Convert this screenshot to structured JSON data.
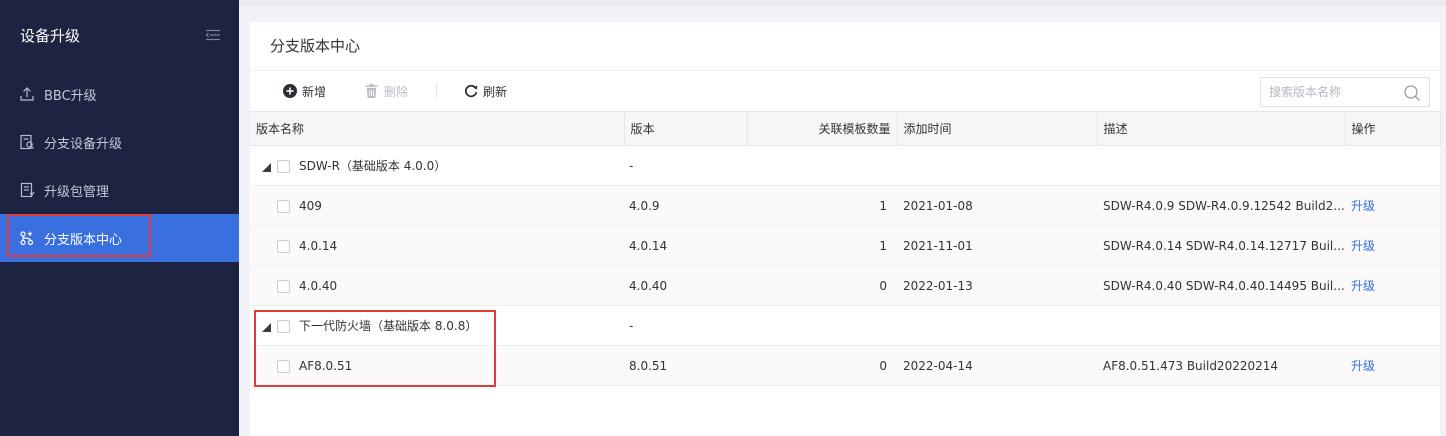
{
  "sidebar": {
    "title": "设备升级",
    "collapse_icon": "collapse-icon",
    "items": [
      {
        "label": "BBC升级",
        "icon": "upload-icon",
        "active": false
      },
      {
        "label": "分支设备升级",
        "icon": "device-search-icon",
        "active": false
      },
      {
        "label": "升级包管理",
        "icon": "package-icon",
        "active": false
      },
      {
        "label": "分支版本中心",
        "icon": "branch-version-icon",
        "active": true
      }
    ]
  },
  "panel": {
    "title": "分支版本中心"
  },
  "toolbar": {
    "add_label": "新增",
    "delete_label": "删除",
    "refresh_label": "刷新",
    "search_placeholder": "搜索版本名称"
  },
  "table": {
    "columns": [
      "版本名称",
      "版本",
      "关联模板数量",
      "添加时间",
      "描述",
      "操作"
    ],
    "groups": [
      {
        "name": "SDW-R（基础版本 4.0.0）",
        "version": "-",
        "rows": [
          {
            "name": "409",
            "version": "4.0.9",
            "count": "1",
            "added": "2021-01-08",
            "desc": "SDW-R4.0.9 SDW-R4.0.9.12542 Build2...",
            "action": "升级"
          },
          {
            "name": "4.0.14",
            "version": "4.0.14",
            "count": "1",
            "added": "2021-11-01",
            "desc": "SDW-R4.0.14 SDW-R4.0.14.12717 Buil...",
            "action": "升级"
          },
          {
            "name": "4.0.40",
            "version": "4.0.40",
            "count": "0",
            "added": "2022-01-13",
            "desc": "SDW-R4.0.40 SDW-R4.0.40.14495 Buil...",
            "action": "升级"
          }
        ]
      },
      {
        "name": "下一代防火墙（基础版本 8.0.8）",
        "version": "-",
        "rows": [
          {
            "name": "AF8.0.51",
            "version": "8.0.51",
            "count": "0",
            "added": "2022-04-14",
            "desc": "AF8.0.51.473 Build20220214",
            "action": "升级"
          }
        ]
      }
    ]
  },
  "colors": {
    "sidebar_bg": "#1c2442",
    "active_bg": "#3a6fe0",
    "link": "#2f6fe0",
    "highlight_outline": "#e03a3a"
  }
}
